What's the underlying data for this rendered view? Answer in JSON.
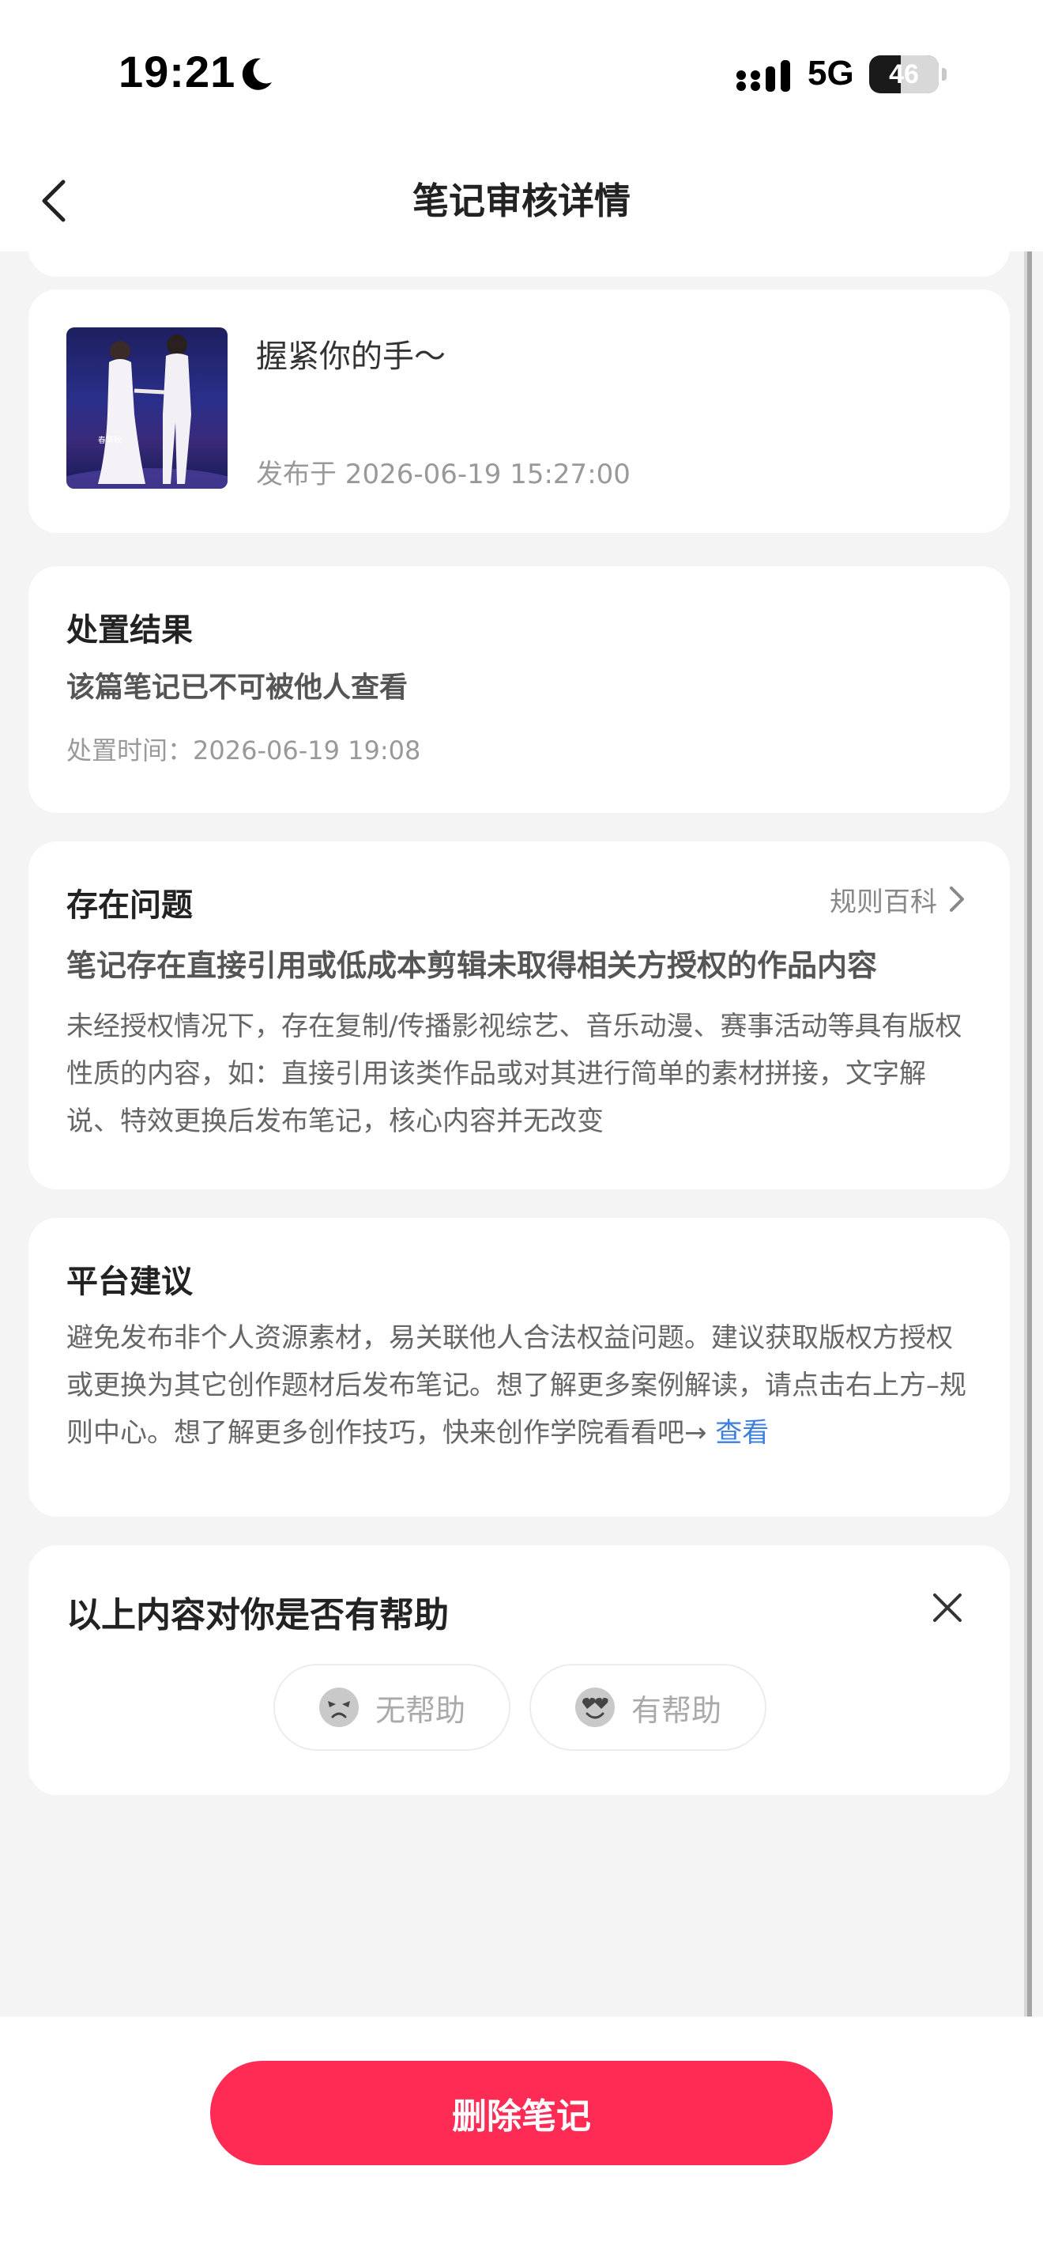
{
  "status_bar": {
    "time": "19:21",
    "network": "5G",
    "battery": "46",
    "battery_level_percent": 46
  },
  "header": {
    "title": "笔记审核详情"
  },
  "note": {
    "title": "握紧你的手～",
    "published": "发布于 2026-06-19 15:27:00"
  },
  "result": {
    "heading": "处置结果",
    "status": "该篇笔记已不可被他人查看",
    "time": "处置时间：2026-06-19 19:08"
  },
  "issue": {
    "heading": "存在问题",
    "rules_link": "规则百科",
    "summary": "笔记存在直接引用或低成本剪辑未取得相关方授权的作品内容",
    "detail": "未经授权情况下，存在复制/传播影视综艺、音乐动漫、赛事活动等具有版权性质的内容，如：直接引用该类作品或对其进行简单的素材拼接，文字解说、特效更换后发布笔记，核心内容并无改变"
  },
  "advice": {
    "heading": "平台建议",
    "body": "避免发布非个人资源素材，易关联他人合法权益问题。建议获取版权方授权或更换为其它创作题材后发布笔记。想了解更多案例解读，请点击右上方–规则中心。想了解更多创作技巧，快来创作学院看看吧→ ",
    "link": "查看"
  },
  "feedback": {
    "title": "以上内容对你是否有帮助",
    "unhelpful": "无帮助",
    "helpful": "有帮助"
  },
  "footer": {
    "delete_label": "删除笔记"
  },
  "colors": {
    "accent": "#fe2c55",
    "link": "#3d7fe0"
  },
  "icons": [
    "moon-icon",
    "signal-icon",
    "back-chevron-icon",
    "chevron-right-icon",
    "close-icon",
    "sad-face-icon",
    "happy-face-icon"
  ]
}
